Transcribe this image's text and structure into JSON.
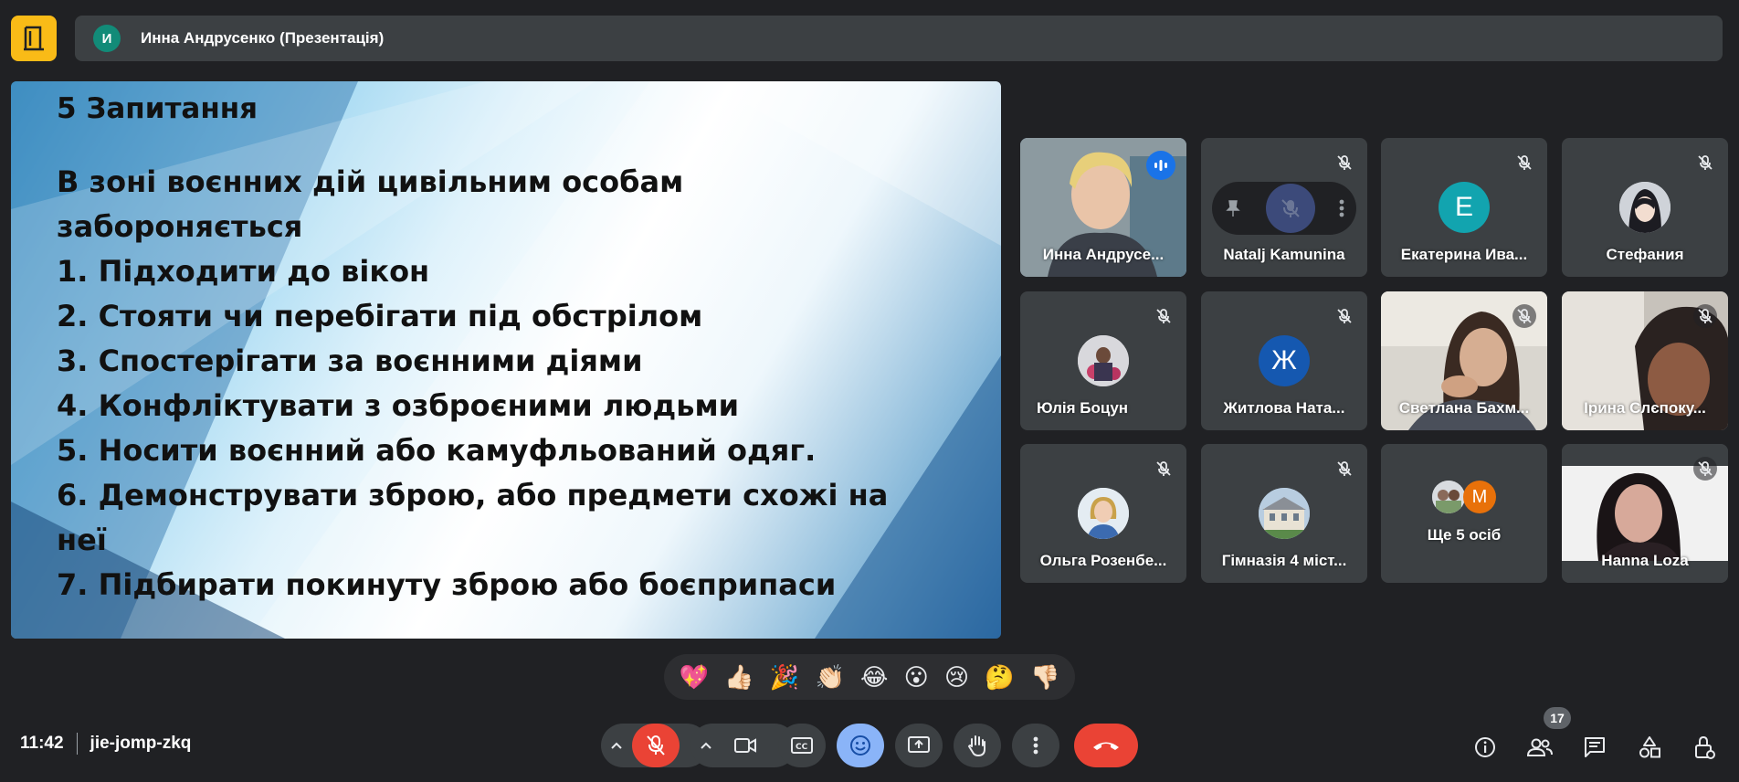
{
  "header": {
    "avatar_letter": "И",
    "title": "Инна Андрусенко (Презентація)"
  },
  "slide": {
    "title": "5 Запитання",
    "lines": [
      "В зоні воєнних дій цивільним особам",
      "забороняється",
      "1. Підходити до вікон",
      "2. Стояти чи перебігати під обстрілом",
      "3. Спостерігати за воєнними діями",
      "4. Конфліктувати з озброєними людьми",
      "5. Носити воєнний або камуфльований одяг.",
      "6. Демонструвати зброю, або предмети схожі на",
      "неї",
      "7. Підбирати покинуту зброю або боєприпаси"
    ]
  },
  "participants": [
    {
      "name": "Инна Андрусе...",
      "type": "video"
    },
    {
      "name": "Natalj Kamunina",
      "type": "hover"
    },
    {
      "name": "Екатерина Ива...",
      "type": "letter",
      "letter": "E",
      "color": "#12a4af"
    },
    {
      "name": "Стефания",
      "type": "photo"
    },
    {
      "name": "Юлія Боцун",
      "type": "photo"
    },
    {
      "name": "Житлова Ната...",
      "type": "letter",
      "letter": "Ж",
      "color": "#1558b0"
    },
    {
      "name": "Светлана Бахм...",
      "type": "video"
    },
    {
      "name": "Ірина Слєпоку...",
      "type": "video"
    },
    {
      "name": "Ольга Розенбе...",
      "type": "photo"
    },
    {
      "name": "Гімназія 4 міст...",
      "type": "photo"
    },
    {
      "name": "Ще 5 осіб",
      "type": "more",
      "letter": "M",
      "color": "#e8710a"
    },
    {
      "name": "Hanna Loza",
      "type": "video"
    }
  ],
  "reactions": [
    "💖",
    "👍🏻",
    "🎉",
    "👏🏻",
    "😂",
    "😮",
    "😢",
    "🤔",
    "👎🏻"
  ],
  "meeting": {
    "time": "11:42",
    "code": "jie-jomp-zkq"
  },
  "people_count": "17",
  "colors": {
    "background": "#202124",
    "tile": "#3c4043",
    "accent_blue": "#8ab4f8",
    "danger_red": "#ea4335",
    "logo_yellow": "#f9bb17"
  },
  "icons": [
    "mic-off-icon",
    "camera-icon",
    "captions-icon",
    "emoji-icon",
    "present-icon",
    "hand-icon",
    "more-icon",
    "end-call-icon",
    "info-icon",
    "people-icon",
    "chat-icon",
    "activities-icon",
    "lock-icon"
  ]
}
